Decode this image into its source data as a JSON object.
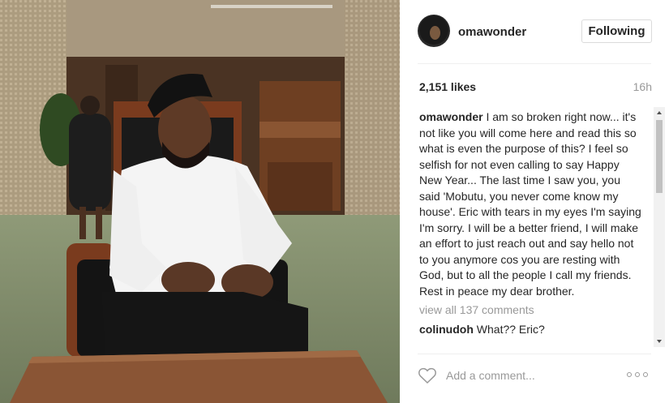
{
  "post": {
    "username": "omawonder",
    "follow_label": "Following",
    "likes": "2,151 likes",
    "timestamp": "16h",
    "caption": {
      "user": "omawonder",
      "text": "I am so broken right now... it's not like you will come here and read this so what is even the purpose of this? I feel so selfish for not even calling to say Happy New Year... The last time I saw you, you said 'Mobutu, you never come know my house'. Eric with tears in my eyes I'm saying I'm sorry. I will be a better friend, I will make an effort to just reach out and say hello not to you anymore cos you are resting with God, but to all the people I call my friends. Rest in peace my dear brother."
    },
    "view_all_comments": "view all 137 comments",
    "comments": [
      {
        "user": "colinudoh",
        "text": "What?? Eric?"
      }
    ],
    "add_comment_placeholder": "Add a comment..."
  },
  "icons": {
    "like": "heart-icon",
    "more": "more-options-icon",
    "avatar": "avatar"
  },
  "colors": {
    "link_gray": "#999999",
    "text": "#262626",
    "border": "#dbdbdb"
  }
}
